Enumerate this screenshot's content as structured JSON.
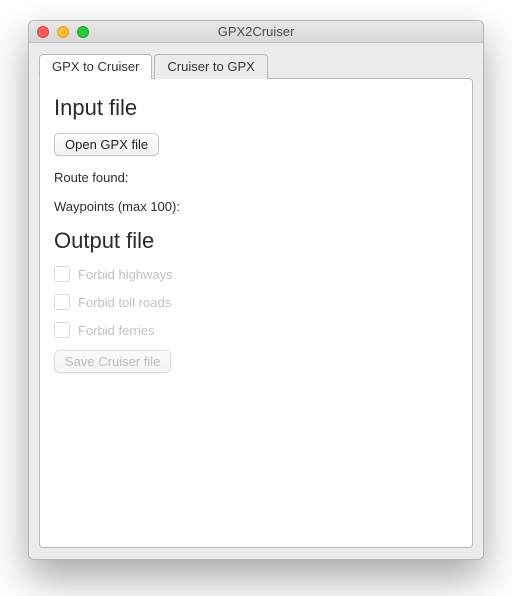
{
  "window": {
    "title": "GPX2Cruiser"
  },
  "tabs": [
    {
      "label": "GPX to Cruiser"
    },
    {
      "label": "Cruiser to GPX"
    }
  ],
  "sections": {
    "input": {
      "heading": "Input file",
      "open_btn": "Open GPX file",
      "route_found": "Route found:",
      "waypoints": "Waypoints (max 100):"
    },
    "output": {
      "heading": "Output file",
      "checkboxes": {
        "highways": "Forbid highways",
        "tollroads": "Forbid toll roads",
        "ferries": "Forbid ferries"
      },
      "save_btn": "Save Cruiser file"
    }
  }
}
